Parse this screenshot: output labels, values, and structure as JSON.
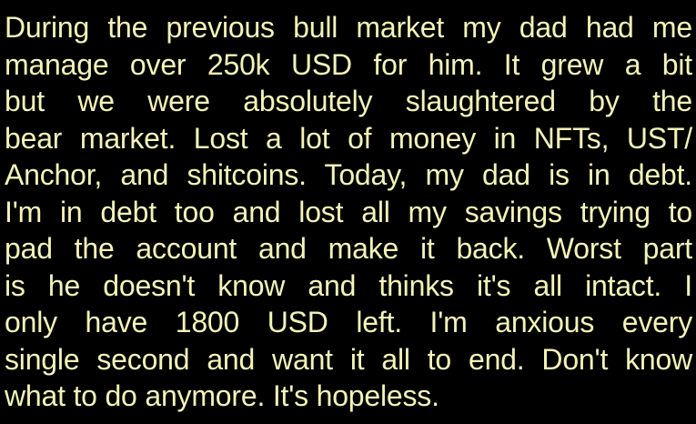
{
  "post": {
    "lines": [
      "During the previous bull market my dad had me",
      "manage over 250k USD for him. It grew a bit",
      "but we were absolutely slaughtered by the",
      "bear market. Lost a lot of money in NFTs, UST/",
      "Anchor, and shitcoins. Today, my dad is in debt.",
      "I'm in debt too and lost all my savings trying to",
      "pad the account and make it back. Worst part",
      "is he doesn't know and thinks it's all intact. I",
      "only have 1800 USD left. I'm anxious every",
      "single second and want it all to end. Don't know",
      "what to do anymore. It's hopeless."
    ]
  },
  "colors": {
    "background": "#000000",
    "text": "#f4f3b8"
  }
}
